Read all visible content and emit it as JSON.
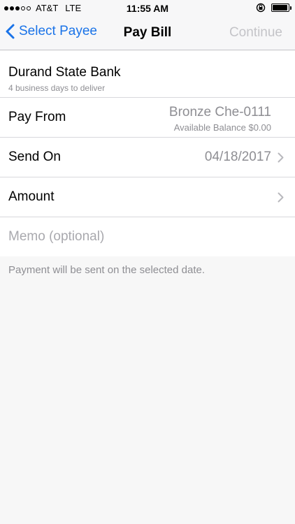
{
  "status_bar": {
    "carrier": "AT&T",
    "network": "LTE",
    "time": "11:55 AM",
    "signal_bars": 3,
    "signal_total": 5,
    "icons": [
      "rotation-lock-icon",
      "battery-icon"
    ]
  },
  "nav": {
    "back_label": "Select Payee",
    "title": "Pay Bill",
    "continue_label": "Continue"
  },
  "payee": {
    "name": "Durand State Bank",
    "delivery": "4 business days to deliver"
  },
  "pay_from": {
    "label": "Pay From",
    "account": "Bronze Che-0111",
    "balance": "Available Balance $0.00"
  },
  "send_on": {
    "label": "Send On",
    "date": "04/18/2017"
  },
  "amount": {
    "label": "Amount"
  },
  "memo": {
    "placeholder": "Memo (optional)"
  },
  "footer": {
    "note": "Payment will be sent on the selected date."
  },
  "colors": {
    "accent": "#1a73e8",
    "disabled": "#c4c4c8",
    "secondary_text": "#8e8e93"
  }
}
